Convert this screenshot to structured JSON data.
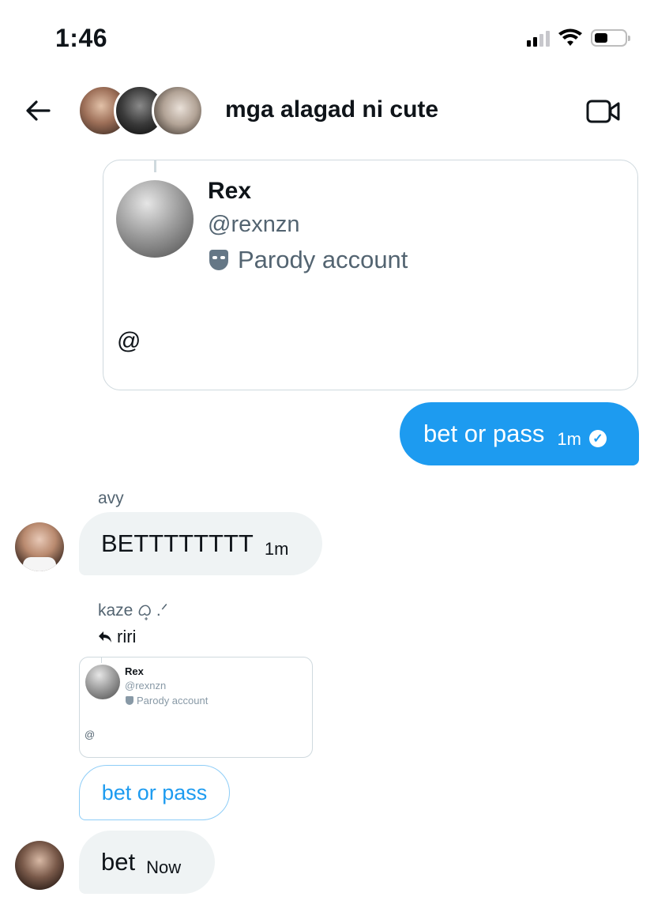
{
  "status_bar": {
    "time": "1:46"
  },
  "header": {
    "title": "mga alagad ni cute",
    "back_icon": "arrow-left-icon",
    "video_icon": "video-camera-icon"
  },
  "quoted_post": {
    "name": "Rex",
    "handle": "@rexnzn",
    "label": "Parody account",
    "text": "@"
  },
  "sent_message": {
    "text": "bet or pass",
    "time": "1m"
  },
  "messages": [
    {
      "sender": "avy",
      "text": "BETTTTTTTT",
      "time": "1m"
    },
    {
      "sender": "kaze ᜊ᜔ .ᐟ",
      "reply_to": "riri",
      "reply_text": "bet or pass",
      "text": "bet",
      "time": "Now"
    }
  ],
  "colors": {
    "accent": "#1d9bf0",
    "bubble_in": "#eff3f4",
    "muted": "#536471"
  }
}
